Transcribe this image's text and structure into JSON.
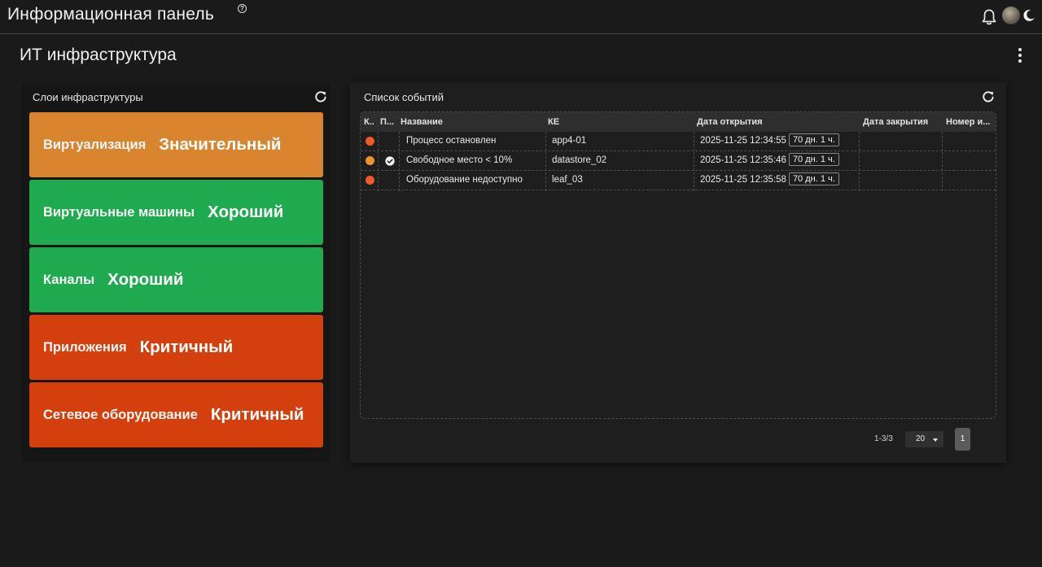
{
  "header": {
    "app_title": "Информационная панель",
    "help_icon": "help-circle-icon",
    "help_glyph": "?",
    "icons": [
      "bell-icon",
      "avatar",
      "moon-icon"
    ]
  },
  "page": {
    "title": "ИТ инфраструктура",
    "menu_icon": "kebab-menu-icon"
  },
  "layers": {
    "title": "Слои инфраструктуры",
    "refresh_icon": "refresh-icon",
    "items": [
      {
        "name": "Виртуализация",
        "status": "Значительный",
        "color": "#D98530"
      },
      {
        "name": "Виртуальные машины",
        "status": "Хороший",
        "color": "#1FAA4F"
      },
      {
        "name": "Каналы",
        "status": "Хороший",
        "color": "#1FAA4F"
      },
      {
        "name": "Приложения",
        "status": "Критичный",
        "color": "#D3400E"
      },
      {
        "name": "Сетевое оборудование",
        "status": "Критичный",
        "color": "#D3400E"
      }
    ]
  },
  "events": {
    "title": "Список событий",
    "refresh_icon": "refresh-icon",
    "columns": [
      "К..",
      "П...",
      "Название",
      "КЕ",
      "Дата открытия",
      "Дата закрытия",
      "Номер и..."
    ],
    "rows": [
      {
        "severity_color": "#F15A22",
        "ack": false,
        "name": "Процесс остановлен",
        "ke": "app4-01",
        "opened": "2025-11-25 12:34:55",
        "age": "70 дн. 1 ч.",
        "closed": "",
        "number": ""
      },
      {
        "severity_color": "#F0932B",
        "ack": true,
        "name": "Свободное место < 10%",
        "ke": "datastore_02",
        "opened": "2025-11-25 12:35:46",
        "age": "70 дн. 1 ч.",
        "closed": "",
        "number": ""
      },
      {
        "severity_color": "#F15A22",
        "ack": false,
        "name": "Оборудование недоступно",
        "ke": "leaf_03",
        "opened": "2025-11-25 12:35:58",
        "age": "70 дн. 1 ч.",
        "closed": "",
        "number": ""
      }
    ],
    "pagination": {
      "range": "1-3/3",
      "page_size": "20",
      "current_page": "1"
    }
  }
}
